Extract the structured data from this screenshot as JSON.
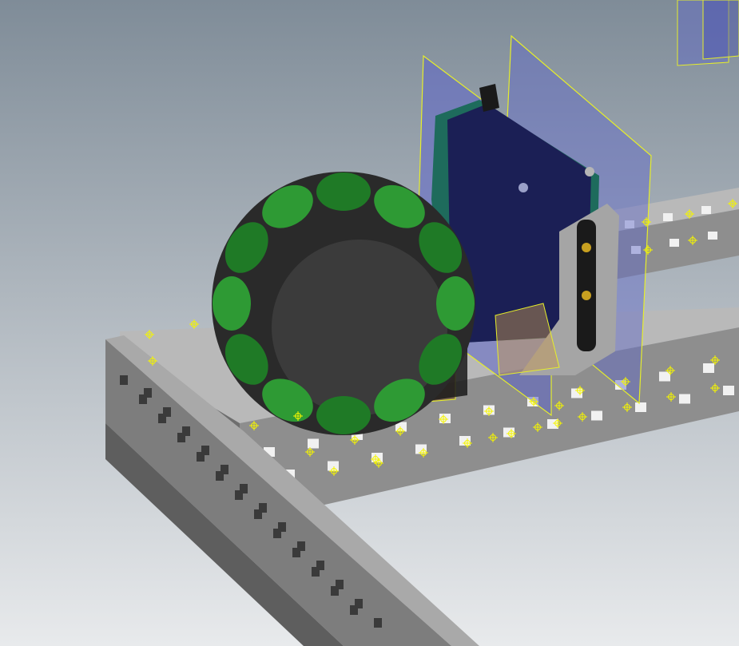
{
  "viewport": {
    "background_top": "#7f8c98",
    "background_bottom": "#e8eaec"
  },
  "colors": {
    "channel_top": "#b9b9b9",
    "channel_face": "#8e8e8e",
    "channel_dark": "#5e5e5e",
    "hole": "#f1f1f1",
    "hole_dark": "#3a3a3a",
    "work_plane": "#5d65c8",
    "work_plane_edge": "#e6ee2a",
    "roller": "#1f7a26",
    "roller_light": "#2e9a34",
    "hub": "#2a2a2a",
    "hub_light": "#3b3b3b",
    "motor_body": "#1b1f55",
    "motor_side": "#1e6b5c",
    "bracket": "#a5a5a5",
    "bearing_block": "#7a5a3a",
    "constraint_marker": "#f5f500"
  },
  "objects": [
    {
      "name": "front-c-channel",
      "kind": "aluminum-channel"
    },
    {
      "name": "side-c-channel",
      "kind": "aluminum-channel"
    },
    {
      "name": "rear-c-channel",
      "kind": "aluminum-channel"
    },
    {
      "name": "omni-wheel",
      "kind": "wheel"
    },
    {
      "name": "servo-motor",
      "kind": "motor"
    },
    {
      "name": "mounting-bracket",
      "kind": "bracket"
    },
    {
      "name": "bearing-block",
      "kind": "pillow-block"
    },
    {
      "name": "work-plane",
      "kind": "reference-plane"
    }
  ]
}
